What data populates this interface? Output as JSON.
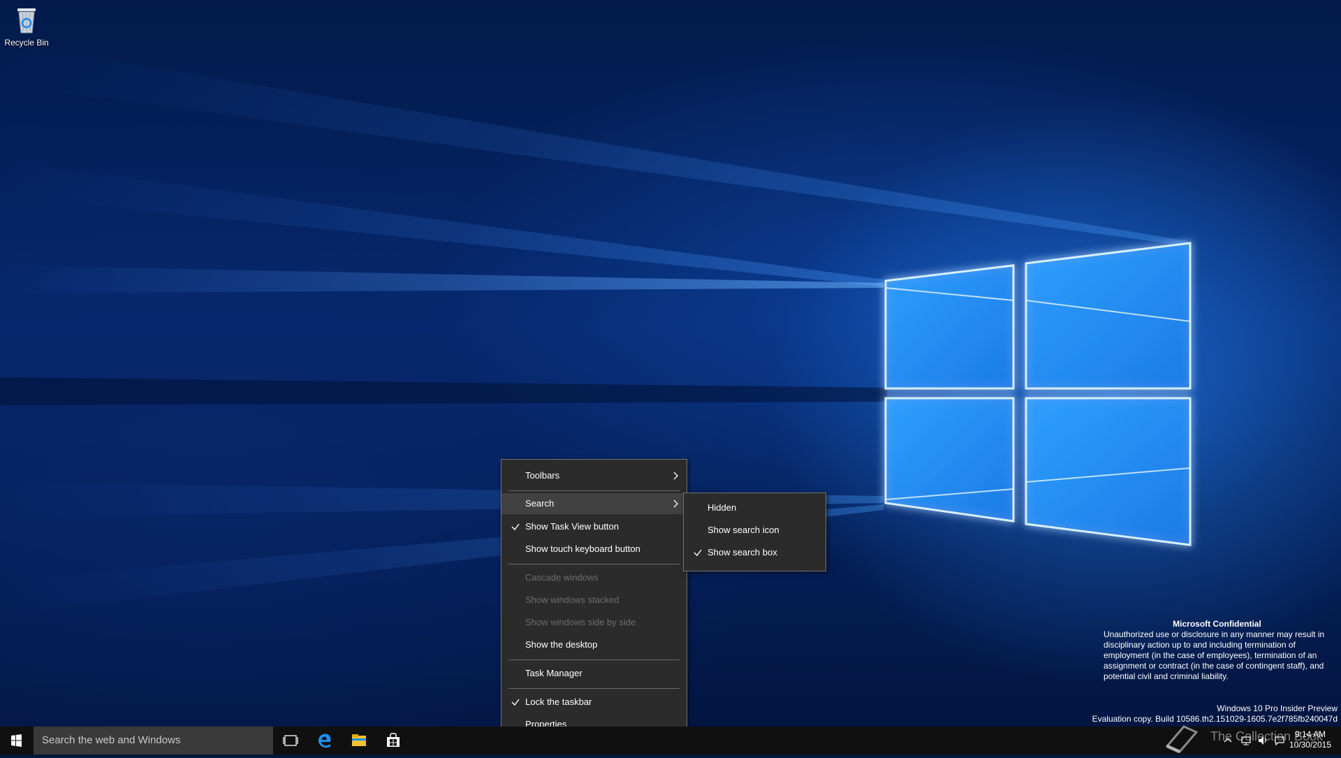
{
  "desktop": {
    "icons": [
      {
        "label": "Recycle Bin",
        "icon": "recycle-bin-icon"
      }
    ]
  },
  "context_menu": {
    "items": [
      {
        "label": "Toolbars",
        "has_submenu": true
      },
      {
        "label": "Search",
        "has_submenu": true,
        "highlighted": true
      },
      {
        "label": "Show Task View button",
        "checked": true
      },
      {
        "label": "Show touch keyboard button"
      },
      {
        "label": "Cascade windows",
        "disabled": true
      },
      {
        "label": "Show windows stacked",
        "disabled": true
      },
      {
        "label": "Show windows side by side",
        "disabled": true
      },
      {
        "label": "Show the desktop"
      },
      {
        "label": "Task Manager"
      },
      {
        "label": "Lock the taskbar",
        "checked": true
      },
      {
        "label": "Properties"
      }
    ]
  },
  "search_submenu": {
    "items": [
      {
        "label": "Hidden"
      },
      {
        "label": "Show search icon"
      },
      {
        "label": "Show search box",
        "checked": true
      }
    ]
  },
  "notice": {
    "title": "Microsoft Confidential",
    "body": "Unauthorized use or disclosure in any manner may result in disciplinary action up to and including termination of employment (in the case of employees), termination of an assignment or contract (in the case of contingent staff), and potential civil and criminal liability."
  },
  "build_info": {
    "edition": "Windows 10 Pro Insider Preview",
    "build": "Evaluation copy. Build 10586.th2.151029-1605.7e2f785fb240047d"
  },
  "taskbar": {
    "search_placeholder": "Search the web and Windows",
    "pinned": [
      "task-view-icon",
      "edge-icon",
      "file-explorer-icon",
      "store-icon"
    ]
  },
  "clock": {
    "time": "9:14 AM",
    "date": "10/30/2015"
  },
  "watermark": "The Collection Book",
  "colors": {
    "menu_bg": "#2b2b2b",
    "menu_highlight": "#414141",
    "taskbar_bg": "#101010",
    "search_bg": "#3a3a3a",
    "accent": "#0078d7"
  }
}
